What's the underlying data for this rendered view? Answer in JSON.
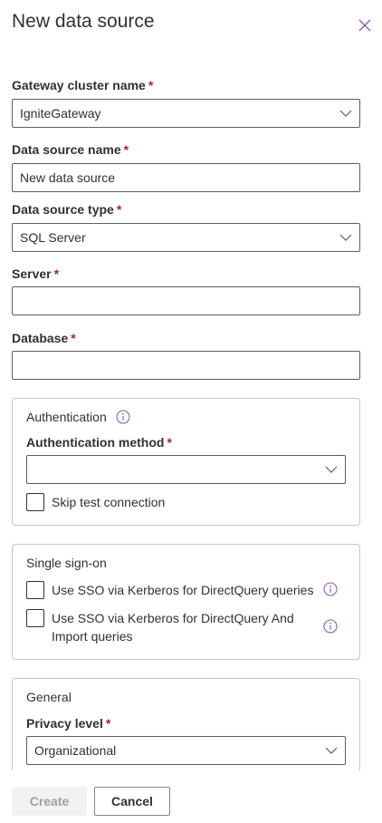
{
  "panel": {
    "title": "New data source",
    "close_icon": "close-icon"
  },
  "form": {
    "gateway": {
      "label": "Gateway cluster name",
      "required": "*",
      "value": "IgniteGateway"
    },
    "datasource_name": {
      "label": "Data source name",
      "required": "*",
      "value": "New data source"
    },
    "datasource_type": {
      "label": "Data source type",
      "required": "*",
      "value": "SQL Server"
    },
    "server": {
      "label": "Server",
      "required": "*",
      "value": ""
    },
    "database": {
      "label": "Database",
      "required": "*",
      "value": ""
    }
  },
  "authentication": {
    "title": "Authentication",
    "method_label": "Authentication method",
    "required": "*",
    "method_value": "",
    "skip_test_label": "Skip test connection"
  },
  "sso": {
    "title": "Single sign-on",
    "option1": "Use SSO via Kerberos for DirectQuery queries",
    "option2_line1": "Use SSO via Kerberos for DirectQuery And",
    "option2_line2": "Import queries"
  },
  "general": {
    "title": "General",
    "privacy_label": "Privacy level",
    "required": "*",
    "privacy_value": "Organizational"
  },
  "footer": {
    "create_label": "Create",
    "cancel_label": "Cancel"
  },
  "colors": {
    "accent": "#8764b8",
    "required": "#a4262c",
    "border": "#605e5c"
  }
}
